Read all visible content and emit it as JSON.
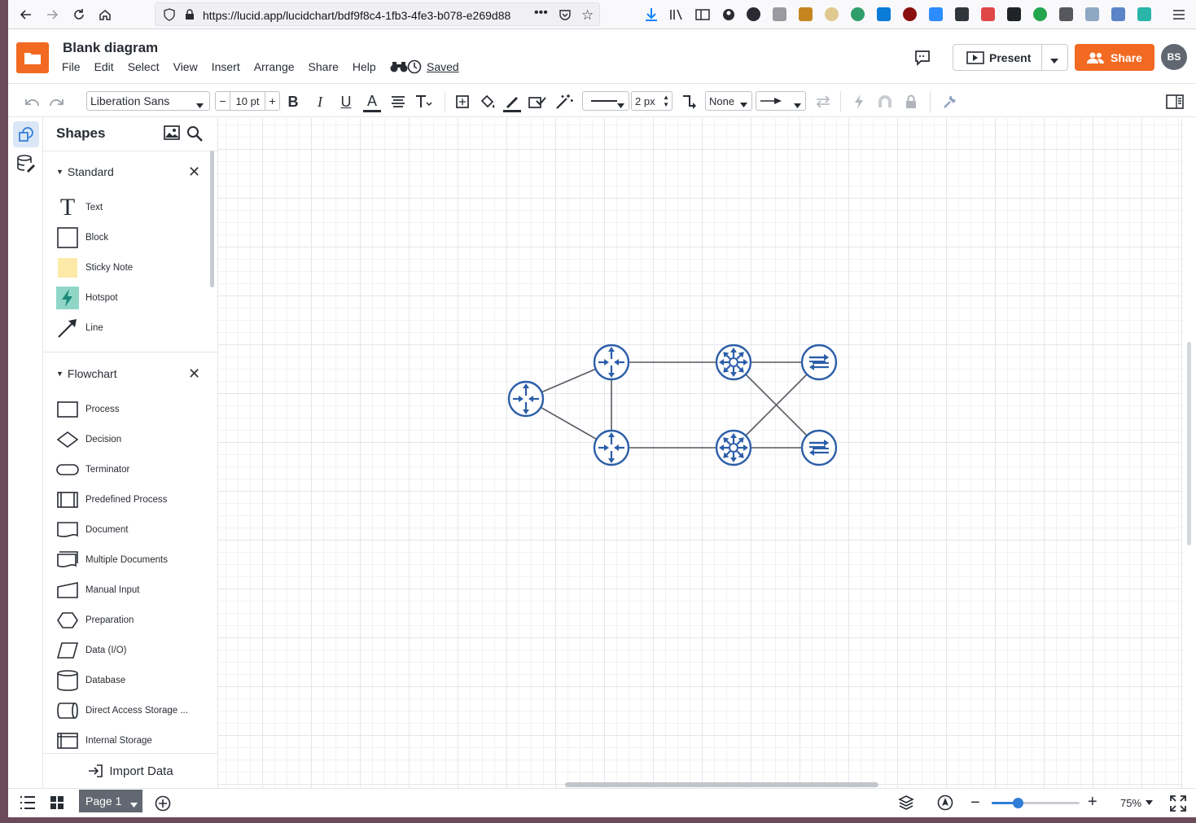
{
  "browser": {
    "url": "https://lucid.app/lucidchart/bdf9f8c4-1fb3-4fe3-b078-e269d88"
  },
  "app": {
    "title": "Blank diagram",
    "menu": [
      "File",
      "Edit",
      "Select",
      "View",
      "Insert",
      "Arrange",
      "Share",
      "Help"
    ],
    "saved_label": "Saved",
    "present_label": "Present",
    "share_label": "Share",
    "avatar_initials": "BS",
    "accent_color": "#f26a21"
  },
  "toolbar": {
    "font_family": "Liberation Sans",
    "font_size": "10 pt",
    "line_width": "2 px",
    "arrow_start": "None",
    "minus": "−",
    "plus": "+"
  },
  "shapes_panel": {
    "title": "Shapes",
    "standard": {
      "label": "Standard",
      "items": [
        "Text",
        "Block",
        "Sticky Note",
        "Hotspot",
        "Line"
      ]
    },
    "flowchart": {
      "label": "Flowchart",
      "items": [
        "Process",
        "Decision",
        "Terminator",
        "Predefined Process",
        "Document",
        "Multiple Documents",
        "Manual Input",
        "Preparation",
        "Data (I/O)",
        "Database",
        "Direct Access Storage ...",
        "Internal Storage"
      ]
    },
    "import_label": "Import Data"
  },
  "diagram": {
    "node_color": "#2c5ea8",
    "nodes": [
      {
        "id": "r1",
        "type": "router"
      },
      {
        "id": "r2",
        "type": "router"
      },
      {
        "id": "r3",
        "type": "router"
      },
      {
        "id": "s1",
        "type": "atm-switch"
      },
      {
        "id": "s2",
        "type": "atm-switch"
      },
      {
        "id": "w1",
        "type": "workgroup-switch"
      },
      {
        "id": "w2",
        "type": "workgroup-switch"
      }
    ],
    "edges": [
      [
        "r1",
        "r2"
      ],
      [
        "r1",
        "r3"
      ],
      [
        "r2",
        "r3"
      ],
      [
        "r2",
        "s1"
      ],
      [
        "r3",
        "s2"
      ],
      [
        "s1",
        "w1"
      ],
      [
        "s2",
        "w2"
      ],
      [
        "s1",
        "w2"
      ],
      [
        "s2",
        "w1"
      ]
    ]
  },
  "bottom": {
    "page_label": "Page 1",
    "zoom_label": "75%",
    "zoom_level": 0.3
  }
}
